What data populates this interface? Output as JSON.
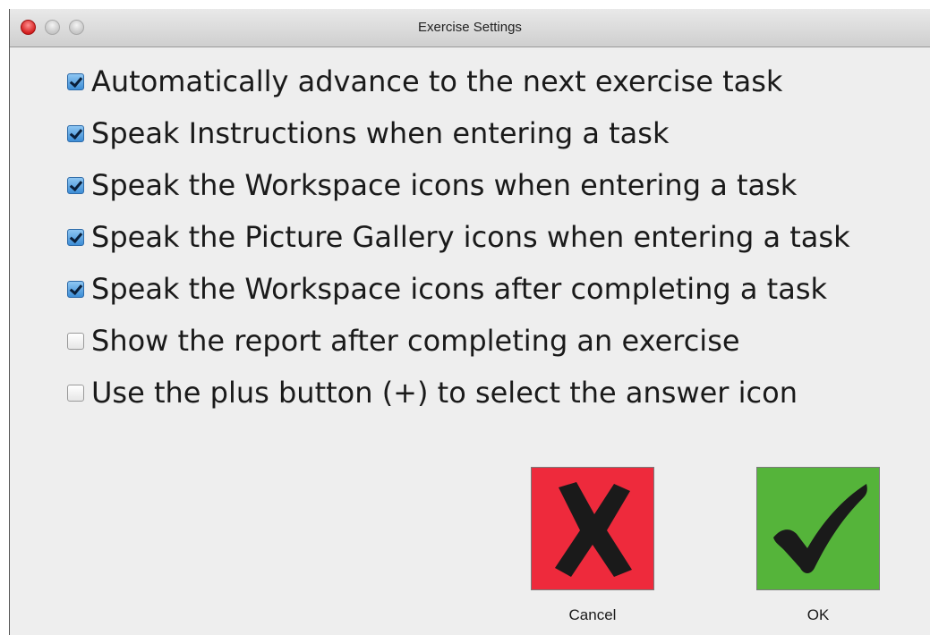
{
  "window": {
    "title": "Exercise Settings"
  },
  "options": [
    {
      "label": "Automatically advance to the next exercise task",
      "checked": true
    },
    {
      "label": "Speak Instructions when entering a task",
      "checked": true
    },
    {
      "label": "Speak the Workspace icons when entering a task",
      "checked": true
    },
    {
      "label": "Speak the Picture Gallery icons when entering a task",
      "checked": true
    },
    {
      "label": "Speak the Workspace icons after completing a task",
      "checked": true
    },
    {
      "label": "Show the report after completing an exercise",
      "checked": false
    },
    {
      "label": "Use the plus button (+) to select the answer icon",
      "checked": false
    }
  ],
  "buttons": {
    "cancel": {
      "label": "Cancel",
      "icon": "x-mark-icon",
      "color": "#ee2a3c"
    },
    "ok": {
      "label": "OK",
      "icon": "checkmark-icon",
      "color": "#55b43a"
    }
  }
}
